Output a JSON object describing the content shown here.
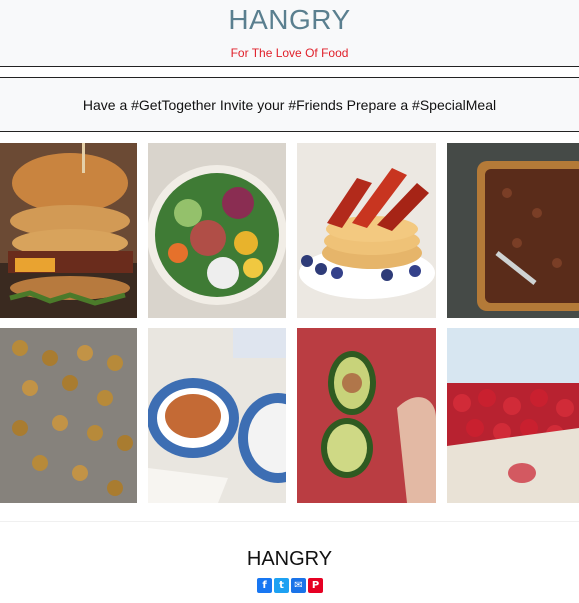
{
  "header": {
    "title": "HANGRY",
    "tagline": "For The Love Of Food"
  },
  "banner": {
    "text": "Have a #GetTogether Invite your #Friends Prepare a #SpecialMeal"
  },
  "gallery": {
    "items": [
      {
        "name": "burger"
      },
      {
        "name": "salad-bowl"
      },
      {
        "name": "pancakes-bacon"
      },
      {
        "name": "chocolate-cake"
      },
      {
        "name": "roasted-chickpeas"
      },
      {
        "name": "tea-cup"
      },
      {
        "name": "avocado"
      },
      {
        "name": "strawberries"
      }
    ]
  },
  "footer": {
    "brand": "HANGRY",
    "social": [
      {
        "icon": "facebook-icon",
        "glyph": "f"
      },
      {
        "icon": "twitter-icon",
        "glyph": "t"
      },
      {
        "icon": "mail-icon",
        "glyph": "✉"
      },
      {
        "icon": "pinterest-icon",
        "glyph": "P"
      }
    ]
  },
  "colors": {
    "brand_title": "#5a7f8f",
    "tagline": "#e0202a"
  }
}
